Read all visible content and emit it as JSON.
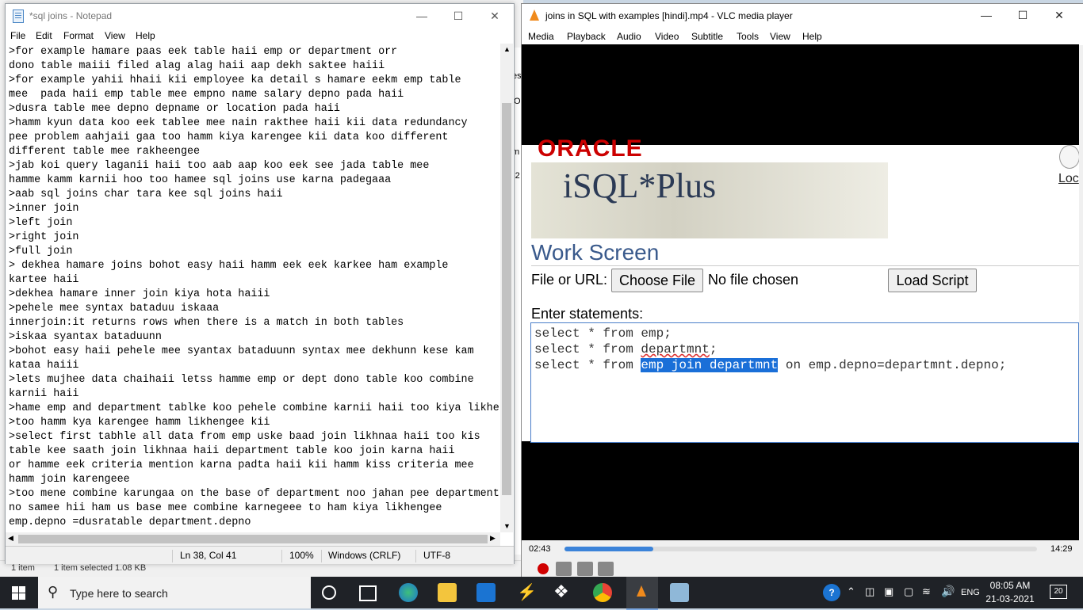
{
  "explorer": {
    "status_items": "1 item",
    "status_selected": "1 item selected  1.08 KB",
    "peek1": "es",
    "peek2": "O",
    "peek3": "m",
    "peek4": "-2"
  },
  "notepad": {
    "title": "*sql joins - Notepad",
    "menu": [
      "File",
      "Edit",
      "Format",
      "View",
      "Help"
    ],
    "lines": [
      ">for example hamare paas eek table haii emp or department orr",
      "dono table maiii filed alag alag haii aap dekh saktee haiii",
      ">for example yahii hhaii kii employee ka detail s hamare eekm emp table",
      "mee  pada haii emp table mee empno name salary depno pada haii",
      ">dusra table mee depno depname or location pada haii",
      ">hamm kyun data koo eek tablee mee nain rakthee haii kii data redundancy",
      "pee problem aahjaii gaa too hamm kiya karengee kii data koo different",
      "different table mee rakheengee",
      ">jab koi query laganii haii too aab aap koo eek see jada table mee",
      "hamme kamm karnii hoo too hamee sql joins use karna padegaaa",
      ">aab sql joins char tara kee sql joins haii",
      ">inner join",
      ">left join",
      ">right join",
      ">full join",
      "> dekhea hamare joins bohot easy haii hamm eek eek karkee ham example",
      "kartee haii",
      ">dekhea hamare inner join kiya hota haiii",
      ">pehele mee syntax bataduu iskaaa",
      "innerjoin:it returns rows when there is a match in both tables",
      ">iskaa syantax bataduunn",
      ">bohot easy haii pehele mee syantax bataduunn syntax mee dekhunn kese kam",
      "kataa haiii",
      ">lets mujhee data chaihaii letss hamme emp or dept dono table koo combine",
      "karnii haii",
      ">hame emp and department tablke koo pehele combine karnii haii too kiya likhe",
      ">too hamm kya karengee hamm likhengee kii",
      ">select first tabhle all data from emp uske baad join likhnaa haii too kis",
      "table kee saath join likhnaa haii department table koo join karna haii",
      "or hamme eek criteria mention karna padta haii kii hamm kiss criteria mee",
      "hamm join karengeee",
      ">too mene combine karungaa on the base of department noo jahan pee department",
      "no samee hii ham us base mee combine karnegeee to ham kiya likhengee",
      "emp.depno =dusratable department.depno"
    ],
    "status": {
      "position": "Ln 38, Col 41",
      "zoom": "100%",
      "line_ending": "Windows (CRLF)",
      "encoding": "UTF-8"
    }
  },
  "vlc": {
    "title": "joins in SQL with examples [hindi].mp4 - VLC media player",
    "menu": [
      "Media",
      "Playback",
      "Audio",
      "Video",
      "Subtitle",
      "Tools",
      "View",
      "Help"
    ],
    "time_elapsed": "02:43",
    "time_total": "14:29",
    "progress": 0.188
  },
  "isqlplus": {
    "brand": "ORACLE",
    "product": "iSQL*Plus",
    "logout": "Loc",
    "heading": "Work Screen",
    "file_label": "File or URL:",
    "choose_file": "Choose File",
    "no_file": "No file chosen",
    "load_script": "Load Script",
    "enter_label": "Enter statements:",
    "sql1": "select * from emp;",
    "sql2_pre": "select * from ",
    "sql2_word": "departmnt",
    "sql2_post": ";",
    "sql3_pre": "select * from ",
    "sql3_sel": "emp join departmnt",
    "sql3_post": " on emp.depno=departmnt.depno;"
  },
  "taskbar": {
    "search_placeholder": "Type here to search",
    "language": "ENG",
    "time": "08:05 AM",
    "date": "21-03-2021",
    "notifications": "20"
  }
}
